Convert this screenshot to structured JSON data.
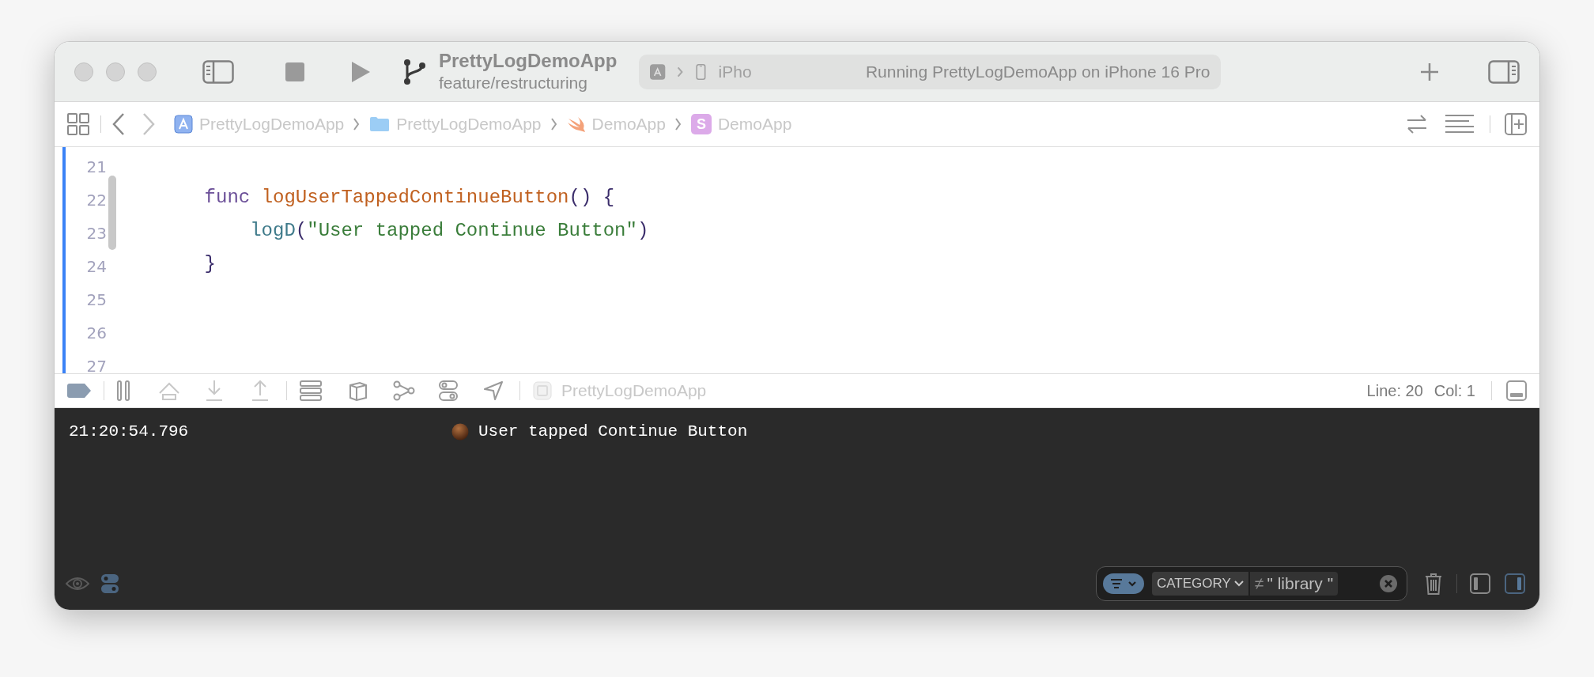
{
  "toolbar": {
    "scheme": "PrettyLogDemoApp",
    "branch": "feature/restructuring",
    "destination": "iPho",
    "status": "Running PrettyLogDemoApp on iPhone 16 Pro"
  },
  "breadcrumbs": [
    {
      "kind": "project",
      "label": "PrettyLogDemoApp"
    },
    {
      "kind": "folder",
      "label": "PrettyLogDemoApp"
    },
    {
      "kind": "swift",
      "label": "DemoApp"
    },
    {
      "kind": "struct",
      "icon_letter": "S",
      "label": "DemoApp"
    }
  ],
  "editor": {
    "lines": [
      {
        "number": "21"
      },
      {
        "number": "22",
        "tokens": [
          {
            "kind": "keyword",
            "text": "    func "
          },
          {
            "kind": "declaration",
            "text": "logUserTappedContinueButton"
          },
          {
            "kind": "plain",
            "text": "() {"
          }
        ]
      },
      {
        "number": "23",
        "tokens": [
          {
            "kind": "call",
            "text": "        logD"
          },
          {
            "kind": "plain",
            "text": "("
          },
          {
            "kind": "string",
            "text": "\"User tapped Continue Button\""
          },
          {
            "kind": "plain",
            "text": ")"
          }
        ]
      },
      {
        "number": "24",
        "tokens": [
          {
            "kind": "plain",
            "text": "    }"
          }
        ]
      },
      {
        "number": "25"
      },
      {
        "number": "26"
      },
      {
        "number": "27"
      }
    ]
  },
  "debug_bar": {
    "process": "PrettyLogDemoApp",
    "line": "Line: 20",
    "column": "Col: 1"
  },
  "console": {
    "entries": [
      {
        "time": "21:20:54.796",
        "message": "User tapped Continue Button"
      }
    ],
    "filter": {
      "field": "CATEGORY",
      "operator": "≠",
      "value": "\" library \""
    }
  }
}
